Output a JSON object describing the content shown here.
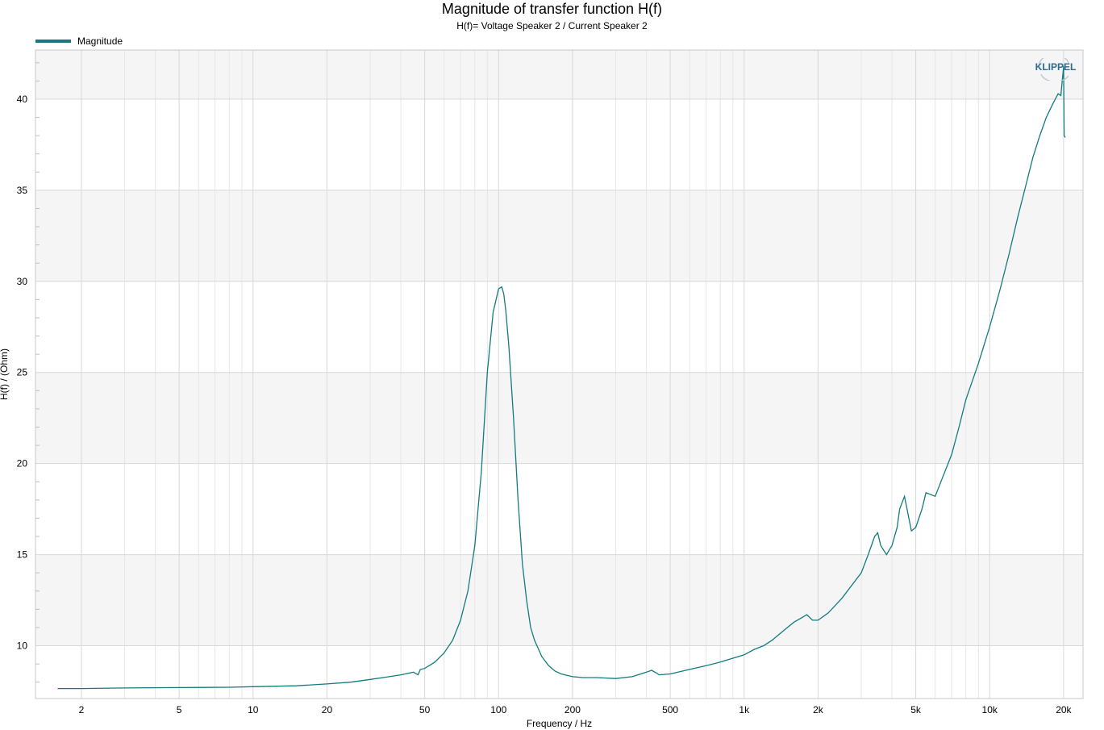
{
  "colors": {
    "line": "#137b7f",
    "band": "#f5f5f5",
    "grid_major": "#d8d8d8",
    "grid_minor": "#e6e6e6",
    "logo": "#2f6c8f"
  },
  "logo_text": "KLIPPEL",
  "chart_data": {
    "type": "line",
    "title": "Magnitude of transfer function H(f)",
    "subtitle": "H(f)= Voltage Speaker 2 / Current Speaker 2",
    "xlabel": "Frequency / Hz",
    "ylabel": "H(f) / (Ohm)",
    "xscale": "log",
    "xlim": [
      1.3,
      24000
    ],
    "ylim": [
      7.1,
      42.7
    ],
    "xticks": [
      2,
      5,
      10,
      20,
      50,
      100,
      200,
      500,
      1000,
      2000,
      5000,
      10000,
      20000
    ],
    "xtick_labels": [
      "2",
      "5",
      "10",
      "20",
      "50",
      "100",
      "200",
      "500",
      "1k",
      "2k",
      "5k",
      "10k",
      "20k"
    ],
    "yticks": [
      10,
      15,
      20,
      25,
      30,
      35,
      40
    ],
    "grid": true,
    "legend_position": "top-left",
    "series": [
      {
        "name": "Magnitude",
        "x": [
          1.6,
          2,
          3,
          5,
          8,
          10,
          15,
          20,
          25,
          30,
          35,
          40,
          45,
          47,
          48,
          50,
          55,
          60,
          65,
          70,
          75,
          80,
          85,
          90,
          95,
          100,
          103,
          105,
          107,
          110,
          115,
          120,
          125,
          130,
          135,
          140,
          150,
          160,
          170,
          180,
          200,
          220,
          250,
          300,
          350,
          400,
          420,
          440,
          450,
          500,
          600,
          700,
          800,
          1000,
          1100,
          1200,
          1300,
          1500,
          1600,
          1700,
          1800,
          1900,
          2000,
          2200,
          2500,
          3000,
          3200,
          3400,
          3500,
          3600,
          3800,
          4000,
          4200,
          4300,
          4500,
          4800,
          5000,
          5300,
          5500,
          6000,
          6500,
          7000,
          7500,
          8000,
          9000,
          10000,
          11000,
          12000,
          13000,
          14000,
          15000,
          16000,
          17000,
          18000,
          19000,
          19500,
          20000,
          20100,
          20300
        ],
        "y": [
          7.65,
          7.65,
          7.68,
          7.7,
          7.72,
          7.75,
          7.8,
          7.9,
          8.0,
          8.15,
          8.28,
          8.4,
          8.55,
          8.4,
          8.7,
          8.75,
          9.1,
          9.6,
          10.3,
          11.4,
          13.0,
          15.5,
          19.5,
          25.0,
          28.3,
          29.6,
          29.7,
          29.3,
          28.4,
          26.5,
          22.5,
          18.0,
          14.5,
          12.5,
          11.0,
          10.3,
          9.4,
          8.9,
          8.6,
          8.45,
          8.3,
          8.25,
          8.25,
          8.2,
          8.3,
          8.55,
          8.65,
          8.5,
          8.4,
          8.45,
          8.7,
          8.9,
          9.1,
          9.5,
          9.8,
          10.0,
          10.3,
          11.0,
          11.3,
          11.5,
          11.7,
          11.4,
          11.4,
          11.8,
          12.6,
          14.0,
          15.0,
          16.0,
          16.2,
          15.5,
          15.0,
          15.5,
          16.5,
          17.5,
          18.2,
          16.3,
          16.5,
          17.5,
          18.4,
          18.2,
          19.4,
          20.5,
          22.0,
          23.5,
          25.5,
          27.5,
          29.5,
          31.5,
          33.5,
          35.2,
          36.8,
          38.0,
          39.0,
          39.7,
          40.3,
          40.2,
          41.8,
          38.0,
          37.9
        ]
      }
    ]
  }
}
